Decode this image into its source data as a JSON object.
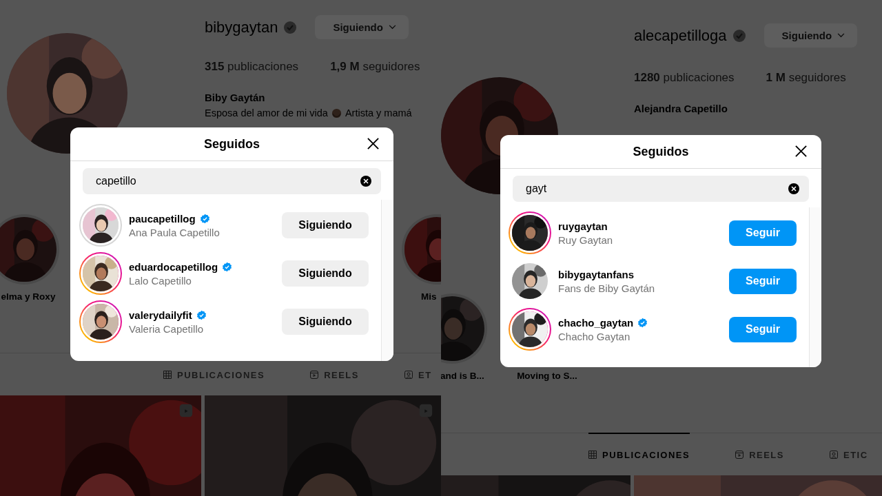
{
  "panels": [
    {
      "profile": {
        "username": "bibygaytan",
        "follow_button": "Siguiendo",
        "posts_stat": "**315** publicaciones",
        "followers_stat": "**1,9 M** seguidores",
        "name": "Biby Gaytán",
        "bio_start": "Esposa del amor de mi vida",
        "bio_end": "Artista y mamá"
      },
      "highlights": [
        {
          "label": "elma y Roxy",
          "kind": "picture"
        },
        {
          "label": "Mis",
          "kind": "picture"
        }
      ],
      "tabs": [
        {
          "label": "PUBLICACIONES",
          "selected": false
        },
        {
          "label": "REELS",
          "selected": false
        },
        {
          "label": "ET",
          "selected": false
        }
      ],
      "posts": [
        {
          "reel": true
        },
        {
          "reel": true
        }
      ],
      "modal": {
        "title": "Seguidos",
        "search": {
          "value": "capetillo"
        },
        "results": [
          {
            "username": "paucapetillog",
            "name": "Ana Paula Capetillo",
            "verified": true,
            "kind": "seen",
            "following": true,
            "button": "Siguiendo"
          },
          {
            "username": "eduardocapetillog",
            "name": "Lalo Capetillo",
            "verified": true,
            "kind": "story",
            "following": true,
            "button": "Siguiendo"
          },
          {
            "username": "valerydailyfit",
            "name": "Valeria Capetillo",
            "verified": true,
            "kind": "story",
            "following": true,
            "button": "Siguiendo"
          }
        ]
      }
    },
    {
      "profile": {
        "username": "alecapetilloga",
        "follow_button": "Siguiendo",
        "posts_stat": "**1280** publicaciones",
        "followers_stat": "**1 M** seguidores",
        "name": "Alejandra Capetillo"
      },
      "highlights": [
        {
          "label": "and is B...",
          "kind": "picture"
        },
        {
          "label": "Moving to S..."
        }
      ],
      "tabs": [
        {
          "label": "PUBLICACIONES",
          "selected": true
        },
        {
          "label": "REELS",
          "selected": false
        },
        {
          "label": "ETIC",
          "selected": false
        }
      ],
      "posts": [
        {
          "reel": false
        },
        {
          "reel": false
        }
      ],
      "modal": {
        "title": "Seguidos",
        "search": {
          "value": "gayt"
        },
        "results": [
          {
            "username": "ruygaytan",
            "name": "Ruy Gaytan",
            "verified": false,
            "kind": "story",
            "following": false,
            "button": "Seguir"
          },
          {
            "username": "bibygaytanfans",
            "name": "Fans de Biby Gaytán",
            "verified": false,
            "kind": "plain",
            "following": false,
            "button": "Seguir"
          },
          {
            "username": "chacho_gaytan",
            "name": "Chacho Gaytan",
            "verified": true,
            "kind": "story",
            "following": false,
            "button": "Seguir"
          }
        ]
      }
    }
  ]
}
